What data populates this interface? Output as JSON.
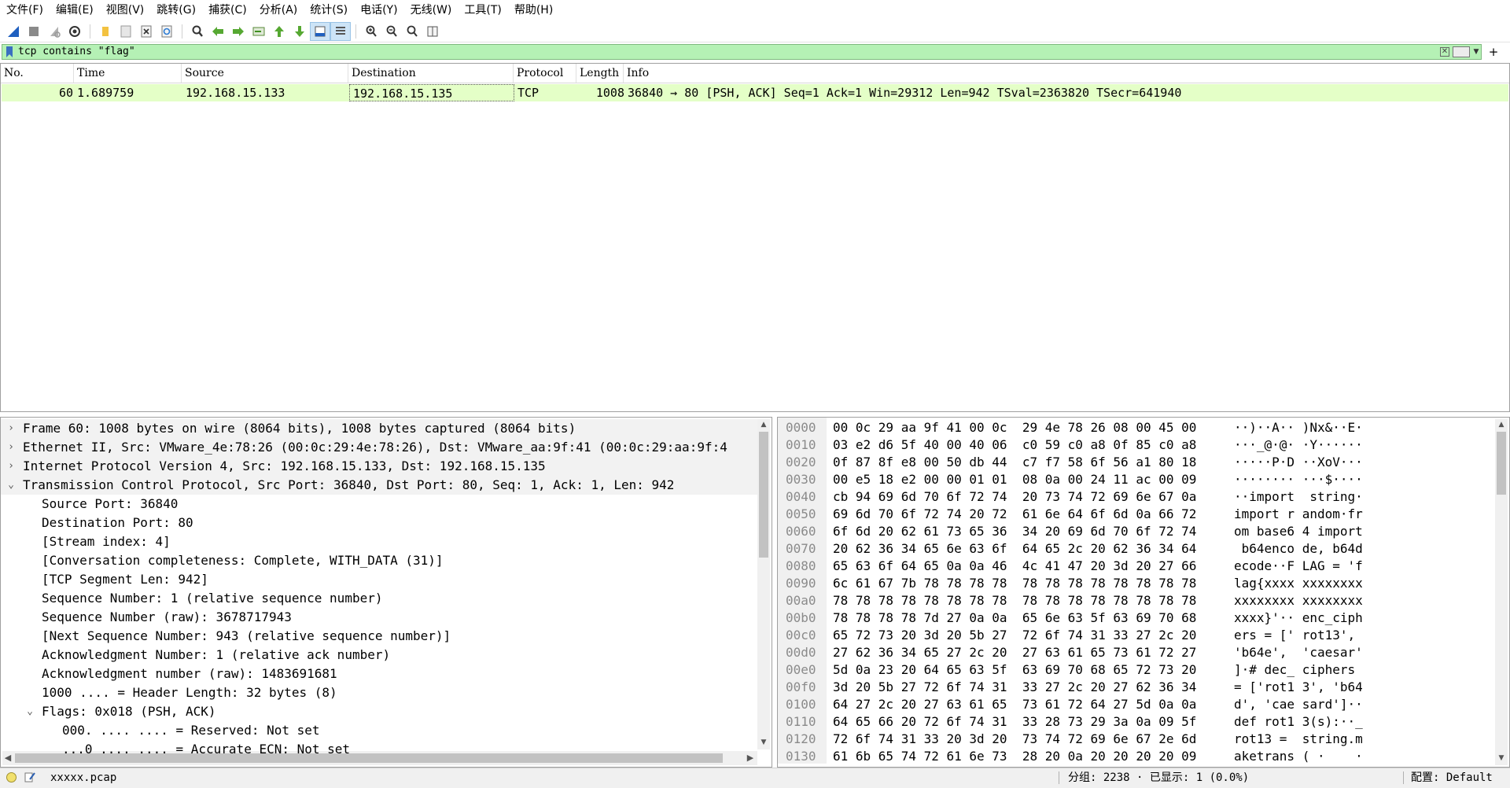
{
  "menu": [
    "文件(F)",
    "编辑(E)",
    "视图(V)",
    "跳转(G)",
    "捕获(C)",
    "分析(A)",
    "统计(S)",
    "电话(Y)",
    "无线(W)",
    "工具(T)",
    "帮助(H)"
  ],
  "toolbar": {
    "icons": [
      "shark-fin-start-icon",
      "stop-square-icon",
      "restart-capture-icon",
      "capture-options-gear-icon",
      "open-folder-icon",
      "save-file-icon",
      "close-file-icon",
      "reload-icon",
      "find-magnifier-icon",
      "go-back-arrow-icon",
      "go-forward-arrow-icon",
      "go-to-packet-icon",
      "first-packet-icon",
      "last-packet-icon",
      "auto-scroll-icon",
      "colorize-icon",
      "zoom-in-icon",
      "zoom-out-icon",
      "zoom-normal-icon",
      "resize-columns-icon"
    ]
  },
  "filter": {
    "value": "tcp contains \"flag\"",
    "bg_color": "#b5f1b5"
  },
  "packet_list": {
    "columns": [
      "No.",
      "Time",
      "Source",
      "Destination",
      "Protocol",
      "Length",
      "Info"
    ],
    "rows": [
      {
        "no": "60",
        "time": "1.689759",
        "source": "192.168.15.133",
        "destination": "192.168.15.135",
        "protocol": "TCP",
        "length": "1008",
        "info": "36840 → 80 [PSH, ACK] Seq=1 Ack=1 Win=29312 Len=942 TSval=2363820 TSecr=641940"
      }
    ],
    "row_color": "#e4ffc7"
  },
  "details": {
    "lines": [
      {
        "arrow": ">",
        "text": "Frame 60: 1008 bytes on wire (8064 bits), 1008 bytes captured (8064 bits)"
      },
      {
        "arrow": ">",
        "text": "Ethernet II, Src: VMware_4e:78:26 (00:0c:29:4e:78:26), Dst: VMware_aa:9f:41 (00:0c:29:aa:9f:4"
      },
      {
        "arrow": ">",
        "text": "Internet Protocol Version 4, Src: 192.168.15.133, Dst: 192.168.15.135"
      },
      {
        "arrow": "v",
        "text": "Transmission Control Protocol, Src Port: 36840, Dst Port: 80, Seq: 1, Ack: 1, Len: 942"
      },
      {
        "arrow": "",
        "text": "Source Port: 36840"
      },
      {
        "arrow": "",
        "text": "Destination Port: 80"
      },
      {
        "arrow": "",
        "text": "[Stream index: 4]"
      },
      {
        "arrow": "",
        "text": "[Conversation completeness: Complete, WITH_DATA (31)]"
      },
      {
        "arrow": "",
        "text": "[TCP Segment Len: 942]"
      },
      {
        "arrow": "",
        "text": "Sequence Number: 1    (relative sequence number)"
      },
      {
        "arrow": "",
        "text": "Sequence Number (raw): 3678717943"
      },
      {
        "arrow": "",
        "text": "[Next Sequence Number: 943    (relative sequence number)]"
      },
      {
        "arrow": "",
        "text": "Acknowledgment Number: 1    (relative ack number)"
      },
      {
        "arrow": "",
        "text": "Acknowledgment number (raw): 1483691681"
      },
      {
        "arrow": "",
        "text": "1000 .... = Header Length: 32 bytes (8)"
      },
      {
        "arrow": "v",
        "text": "Flags: 0x018 (PSH, ACK)"
      },
      {
        "arrow": "",
        "text": "000. .... .... = Reserved: Not set"
      },
      {
        "arrow": "",
        "text": "...0 .... .... = Accurate ECN: Not set"
      }
    ]
  },
  "bytes": {
    "rows": [
      {
        "off": "0000",
        "hex": "00 0c 29 aa 9f 41 00 0c  29 4e 78 26 08 00 45 00",
        "asc": "··)··A·· )Nx&··E·"
      },
      {
        "off": "0010",
        "hex": "03 e2 d6 5f 40 00 40 06  c0 59 c0 a8 0f 85 c0 a8",
        "asc": "···_@·@· ·Y······"
      },
      {
        "off": "0020",
        "hex": "0f 87 8f e8 00 50 db 44  c7 f7 58 6f 56 a1 80 18",
        "asc": "·····P·D ··XoV···"
      },
      {
        "off": "0030",
        "hex": "00 e5 18 e2 00 00 01 01  08 0a 00 24 11 ac 00 09",
        "asc": "········ ···$····"
      },
      {
        "off": "0040",
        "hex": "cb 94 69 6d 70 6f 72 74  20 73 74 72 69 6e 67 0a",
        "asc": "··import  string·"
      },
      {
        "off": "0050",
        "hex": "69 6d 70 6f 72 74 20 72  61 6e 64 6f 6d 0a 66 72",
        "asc": "import r andom·fr"
      },
      {
        "off": "0060",
        "hex": "6f 6d 20 62 61 73 65 36  34 20 69 6d 70 6f 72 74",
        "asc": "om base6 4 import"
      },
      {
        "off": "0070",
        "hex": "20 62 36 34 65 6e 63 6f  64 65 2c 20 62 36 34 64",
        "asc": " b64enco de, b64d"
      },
      {
        "off": "0080",
        "hex": "65 63 6f 64 65 0a 0a 46  4c 41 47 20 3d 20 27 66",
        "asc": "ecode··F LAG = 'f"
      },
      {
        "off": "0090",
        "hex": "6c 61 67 7b 78 78 78 78  78 78 78 78 78 78 78 78",
        "asc": "lag{xxxx xxxxxxxx"
      },
      {
        "off": "00a0",
        "hex": "78 78 78 78 78 78 78 78  78 78 78 78 78 78 78 78",
        "asc": "xxxxxxxx xxxxxxxx"
      },
      {
        "off": "00b0",
        "hex": "78 78 78 78 7d 27 0a 0a  65 6e 63 5f 63 69 70 68",
        "asc": "xxxx}'·· enc_ciph"
      },
      {
        "off": "00c0",
        "hex": "65 72 73 20 3d 20 5b 27  72 6f 74 31 33 27 2c 20",
        "asc": "ers = [' rot13', "
      },
      {
        "off": "00d0",
        "hex": "27 62 36 34 65 27 2c 20  27 63 61 65 73 61 72 27",
        "asc": "'b64e',  'caesar'"
      },
      {
        "off": "00e0",
        "hex": "5d 0a 23 20 64 65 63 5f  63 69 70 68 65 72 73 20",
        "asc": "]·# dec_ ciphers "
      },
      {
        "off": "00f0",
        "hex": "3d 20 5b 27 72 6f 74 31  33 27 2c 20 27 62 36 34",
        "asc": "= ['rot1 3', 'b64"
      },
      {
        "off": "0100",
        "hex": "64 27 2c 20 27 63 61 65  73 61 72 64 27 5d 0a 0a",
        "asc": "d', 'cae sard']··"
      },
      {
        "off": "0110",
        "hex": "64 65 66 20 72 6f 74 31  33 28 73 29 3a 0a 09 5f",
        "asc": "def rot1 3(s):··_"
      },
      {
        "off": "0120",
        "hex": "72 6f 74 31 33 20 3d 20  73 74 72 69 6e 67 2e 6d",
        "asc": "rot13 =  string.m"
      },
      {
        "off": "0130",
        "hex": "61 6b 65 74 72 61 6e 73  28 20 0a 20 20 20 20 09",
        "asc": "aketrans ( ·    ·"
      }
    ]
  },
  "status": {
    "file": "xxxxx.pcap",
    "packets": "分组: 2238 · 已显示: 1 (0.0%)",
    "profile": "配置: Default"
  }
}
